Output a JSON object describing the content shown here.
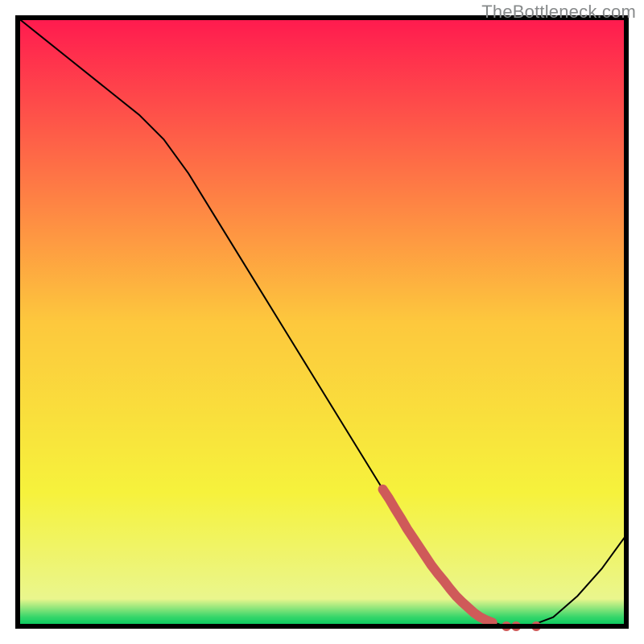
{
  "watermark": "TheBottleneck.com",
  "chart_data": {
    "type": "line",
    "title": "",
    "xlabel": "",
    "ylabel": "",
    "xlim": [
      0,
      100
    ],
    "ylim": [
      0,
      100
    ],
    "x": [
      0,
      4,
      8,
      12,
      16,
      20,
      24,
      28,
      32,
      36,
      40,
      44,
      48,
      52,
      56,
      60,
      64,
      68,
      72,
      76,
      80,
      84,
      88,
      92,
      96,
      100
    ],
    "values": [
      100,
      96.8,
      93.6,
      90.4,
      87.2,
      84.0,
      80.0,
      74.5,
      68.0,
      61.5,
      55.0,
      48.5,
      42.0,
      35.5,
      29.0,
      22.5,
      16.0,
      10.0,
      5.0,
      1.5,
      0.0,
      0.0,
      1.5,
      5.0,
      9.5,
      15.0
    ],
    "highlight_segment": {
      "x": [
        60,
        61,
        62,
        63,
        64,
        65,
        66,
        67,
        68,
        69,
        70,
        71,
        72,
        73,
        74,
        75,
        76,
        77,
        78
      ],
      "values": [
        22.5,
        21.0,
        19.3,
        17.7,
        16.0,
        14.5,
        13.0,
        11.5,
        10.0,
        8.7,
        7.5,
        6.2,
        5.0,
        4.0,
        3.1,
        2.2,
        1.5,
        1.0,
        0.6
      ]
    },
    "highlight_dots": {
      "x": [
        80.3,
        81.9,
        85.2
      ],
      "values": [
        0.0,
        0.0,
        0.0
      ]
    },
    "background": {
      "type": "vertical-gradient-with-green-band",
      "stops": [
        {
          "pos": 0.0,
          "color": "#ff1a4f"
        },
        {
          "pos": 0.5,
          "color": "#fdc83d"
        },
        {
          "pos": 0.78,
          "color": "#f6f23c"
        },
        {
          "pos": 0.955,
          "color": "#eaf68d"
        },
        {
          "pos": 0.985,
          "color": "#35d66a"
        },
        {
          "pos": 1.0,
          "color": "#00c95e"
        }
      ]
    }
  }
}
